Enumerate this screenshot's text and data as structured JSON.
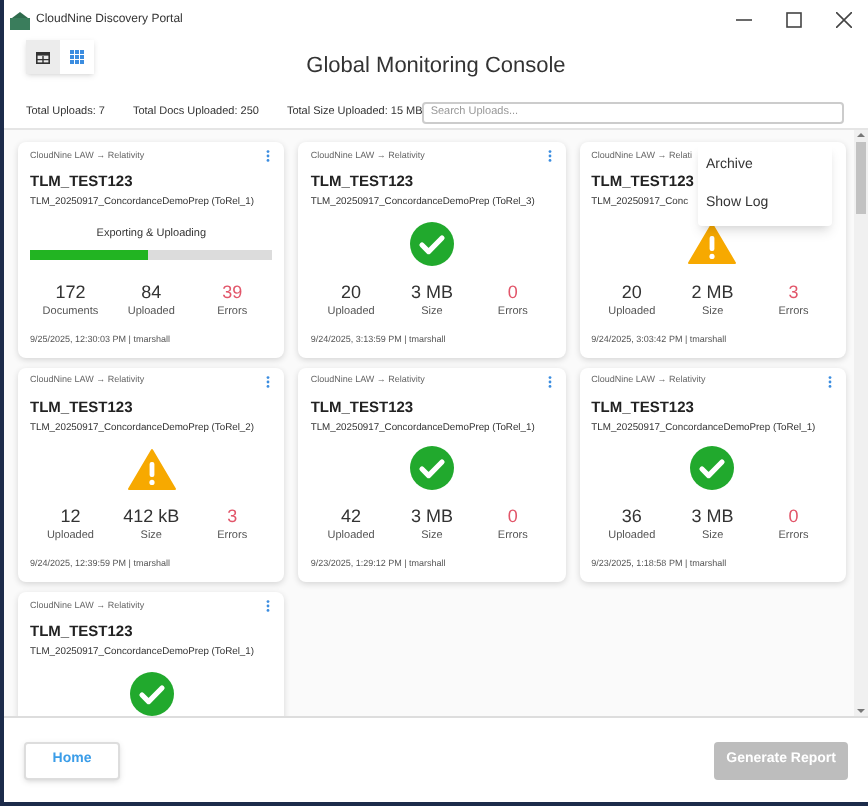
{
  "window": {
    "title": "CloudNine Discovery Portal"
  },
  "views": [
    {
      "kind": "table",
      "selected": false
    },
    {
      "kind": "grid",
      "selected": true
    }
  ],
  "title": "Global Monitoring Console",
  "stats": [
    "Total Uploads: 7",
    "Total Docs Uploaded: 250",
    "Total Size Uploaded: 15 MB"
  ],
  "search": {
    "placeholder": "Search Uploads..."
  },
  "cards": [
    {
      "source": "CloudNine LAW → Relativity",
      "title": "TLM_TEST123",
      "file": "TLM_20250917_ConcordanceDemoPrep (ToRel_1)",
      "status": {
        "kind": "progress",
        "label": "Exporting & Uploading",
        "level": 0.49
      },
      "stats": [
        {
          "value": "172",
          "label": "Documents",
          "kind": "plain"
        },
        {
          "value": "84",
          "label": "Uploaded",
          "kind": "plain"
        },
        {
          "value": "39",
          "label": "Errors",
          "kind": "error"
        }
      ],
      "footer": "9/25/2025, 12:30:03 PM | tmarshall",
      "menu": true
    },
    {
      "source": "CloudNine LAW → Relativity",
      "title": "TLM_TEST123",
      "file": "TLM_20250917_ConcordanceDemoPrep (ToRel_3)",
      "status": {
        "kind": "success"
      },
      "stats": [
        {
          "value": "20",
          "label": "Uploaded",
          "kind": "plain"
        },
        {
          "value": "3 MB",
          "label": "Size",
          "kind": "plain"
        },
        {
          "value": "0",
          "label": "Errors",
          "kind": "error"
        }
      ],
      "footer": "9/24/2025, 3:13:59 PM | tmarshall",
      "menu": true
    },
    {
      "source": "CloudNine LAW → Relati",
      "title": "TLM_TEST123",
      "file": "TLM_20250917_Conc",
      "status": {
        "kind": "warning"
      },
      "stats": [
        {
          "value": "20",
          "label": "Uploaded",
          "kind": "plain"
        },
        {
          "value": "2 MB",
          "label": "Size",
          "kind": "plain"
        },
        {
          "value": "3",
          "label": "Errors",
          "kind": "error"
        }
      ],
      "footer": "9/24/2025, 3:03:42 PM | tmarshall",
      "menu": false
    },
    {
      "source": "CloudNine LAW → Relativity",
      "title": "TLM_TEST123",
      "file": "TLM_20250917_ConcordanceDemoPrep (ToRel_2)",
      "status": {
        "kind": "warning"
      },
      "stats": [
        {
          "value": "12",
          "label": "Uploaded",
          "kind": "plain"
        },
        {
          "value": "412 kB",
          "label": "Size",
          "kind": "plain"
        },
        {
          "value": "3",
          "label": "Errors",
          "kind": "error"
        }
      ],
      "footer": "9/24/2025, 12:39:59 PM | tmarshall",
      "menu": true
    },
    {
      "source": "CloudNine LAW → Relativity",
      "title": "TLM_TEST123",
      "file": "TLM_20250917_ConcordanceDemoPrep (ToRel_1)",
      "status": {
        "kind": "success"
      },
      "stats": [
        {
          "value": "42",
          "label": "Uploaded",
          "kind": "plain"
        },
        {
          "value": "3 MB",
          "label": "Size",
          "kind": "plain"
        },
        {
          "value": "0",
          "label": "Errors",
          "kind": "error"
        }
      ],
      "footer": "9/23/2025, 1:29:12 PM | tmarshall",
      "menu": true
    },
    {
      "source": "CloudNine LAW → Relativity",
      "title": "TLM_TEST123",
      "file": "TLM_20250917_ConcordanceDemoPrep (ToRel_1)",
      "status": {
        "kind": "success"
      },
      "stats": [
        {
          "value": "36",
          "label": "Uploaded",
          "kind": "plain"
        },
        {
          "value": "3 MB",
          "label": "Size",
          "kind": "plain"
        },
        {
          "value": "0",
          "label": "Errors",
          "kind": "error"
        }
      ],
      "footer": "9/23/2025, 1:18:58 PM | tmarshall",
      "menu": true
    },
    {
      "source": "CloudNine LAW → Relativity",
      "title": "TLM_TEST123",
      "file": "TLM_20250917_ConcordanceDemoPrep (ToRel_1)",
      "status": {
        "kind": "success"
      },
      "menu": true
    }
  ],
  "context_menu": [
    "Archive",
    "Show Log"
  ],
  "buttons": [
    {
      "label": "Home",
      "kind": "secondary",
      "disabled": false
    },
    {
      "label": "Generate Report",
      "kind": "primary",
      "disabled": true
    }
  ]
}
